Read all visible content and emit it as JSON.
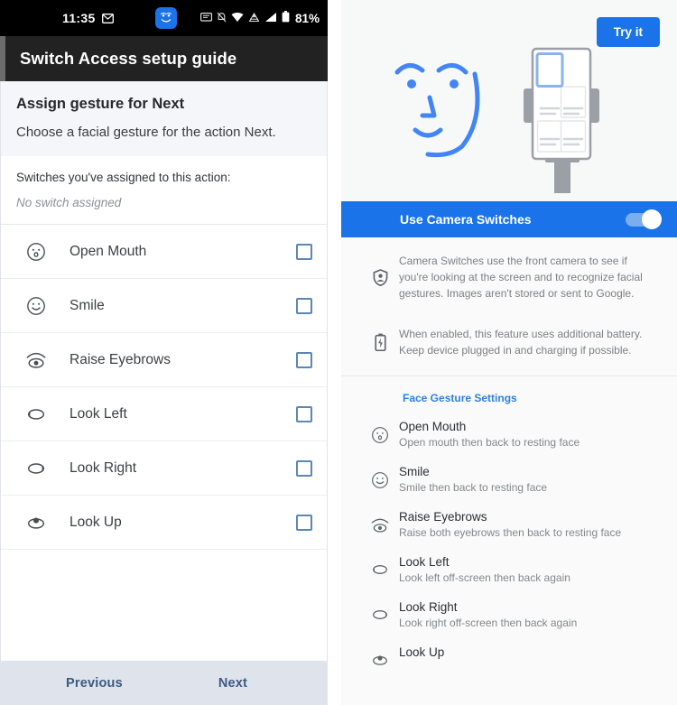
{
  "left": {
    "statusbar": {
      "time": "11:35",
      "battery_percent": "81%",
      "icons": [
        "envelope-icon",
        "face-badge-icon",
        "message-icon",
        "bell-off-icon",
        "wifi-icon",
        "vpn-icon",
        "signal-icon",
        "battery-icon"
      ]
    },
    "appbar": {
      "title": "Switch Access setup guide"
    },
    "intro": {
      "heading": "Assign gesture for Next",
      "body": "Choose a facial gesture for the action Next."
    },
    "assigned": {
      "label": "Switches you've assigned to this action:",
      "value": "No switch assigned"
    },
    "gestures": [
      {
        "icon": "open-mouth-icon",
        "label": "Open Mouth",
        "checked": false
      },
      {
        "icon": "smile-icon",
        "label": "Smile",
        "checked": false
      },
      {
        "icon": "raise-eyebrows-icon",
        "label": "Raise Eyebrows",
        "checked": false
      },
      {
        "icon": "look-left-icon",
        "label": "Look Left",
        "checked": false
      },
      {
        "icon": "look-right-icon",
        "label": "Look Right",
        "checked": false
      },
      {
        "icon": "look-up-icon",
        "label": "Look Up",
        "checked": false
      }
    ],
    "nav": {
      "previous": "Previous",
      "next": "Next"
    }
  },
  "right": {
    "hero": {
      "try_button": "Try it"
    },
    "toggle": {
      "title": "Use Camera Switches",
      "state": "on"
    },
    "info": [
      {
        "icon": "privacy-shield-icon",
        "text": "Camera Switches use the front camera to see if you're looking at the screen and to recognize facial gestures. Images aren't stored or sent to Google."
      },
      {
        "icon": "battery-charging-icon",
        "text": "When enabled, this feature uses additional battery. Keep device plugged in and charging if possible."
      }
    ],
    "section_title": "Face Gesture Settings",
    "gestures": [
      {
        "icon": "open-mouth-icon",
        "title": "Open Mouth",
        "sub": "Open mouth then back to resting face"
      },
      {
        "icon": "smile-icon",
        "title": "Smile",
        "sub": "Smile then back to resting face"
      },
      {
        "icon": "raise-eyebrows-icon",
        "title": "Raise Eyebrows",
        "sub": "Raise both eyebrows then back to resting face"
      },
      {
        "icon": "look-left-icon",
        "title": "Look Left",
        "sub": "Look left off-screen then back again"
      },
      {
        "icon": "look-right-icon",
        "title": "Look Right",
        "sub": "Look right off-screen then back again"
      },
      {
        "icon": "look-up-icon",
        "title": "Look Up",
        "sub": ""
      }
    ]
  },
  "colors": {
    "accent_blue": "#1a73e8",
    "face_blue": "#4285f4",
    "statusbar_bg": "#000000",
    "appbar_bg": "#222222",
    "navbar_bg": "#dee3ec",
    "navbar_text": "#3d5a80",
    "checkbox_border": "#5b87b5",
    "section_title": "#2f7fe0"
  }
}
